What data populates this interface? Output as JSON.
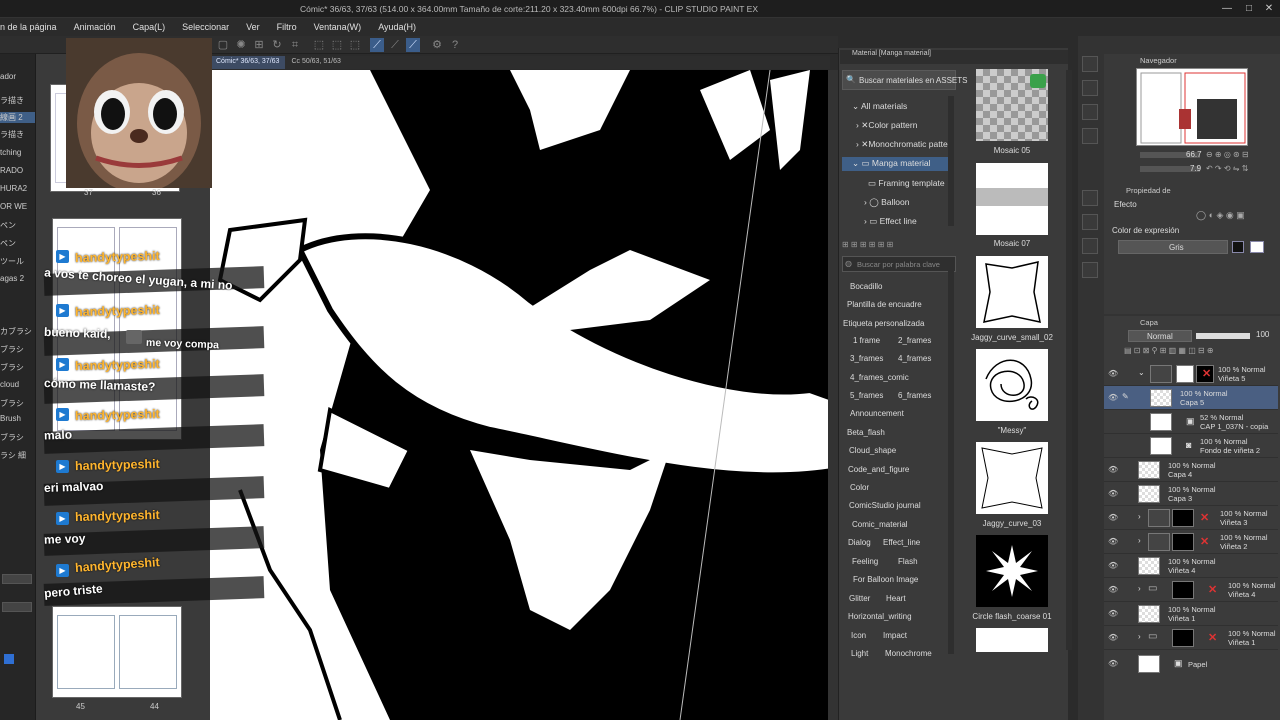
{
  "window": {
    "title": "Cómic* 36/63, 37/63 (514.00 x 364.00mm Tamaño de corte:211.20 x 323.40mm 600dpi 66.7%) - CLIP STUDIO PAINT EX"
  },
  "menu": [
    "n de la página",
    "Animación",
    "Capa(L)",
    "Seleccionar",
    "Ver",
    "Filtro",
    "Ventana(W)",
    "Ayuda(H)"
  ],
  "doc_tabs": [
    "Cómic* 36/63, 37/63",
    "Cc 50/63, 51/63"
  ],
  "left_tools": [
    "ador",
    "ラ描き",
    "線画 2",
    "ラ描き",
    "tching",
    "RADO",
    "HURA2",
    "OR WE",
    "ペン",
    "ペン",
    "ツール",
    "agas 2",
    "カブラシ",
    "ブラシ",
    "ブラシ",
    "cloud",
    "ブラシ",
    "Brush",
    "ブラシ",
    "ラシ 細"
  ],
  "page_numbers": {
    "top_left": "37",
    "top_right": "36",
    "bottom_left": "45",
    "bottom_right": "44"
  },
  "chat": [
    {
      "name": "handytypeshit",
      "message": "a vos te choreo el yugan, a mi no"
    },
    {
      "name": "handytypeshit",
      "message": "bueno kaid,",
      "message_tail": "me voy compa"
    },
    {
      "name": "handytypeshit",
      "message": "cómo me llamaste?"
    },
    {
      "name": "handytypeshit",
      "message": "malo"
    },
    {
      "name": "handytypeshit",
      "message": "eri malvao"
    },
    {
      "name": "handytypeshit",
      "message": "me voy"
    },
    {
      "name": "handytypeshit",
      "message": "pero triste"
    }
  ],
  "material_panel": {
    "header": "Material [Manga material]",
    "assets_button": "Buscar materiales en ASSETS",
    "tree": [
      {
        "label": "All materials",
        "level": 0
      },
      {
        "label": "Color pattern",
        "level": 1
      },
      {
        "label": "Monochromatic patte",
        "level": 1
      },
      {
        "label": "Manga material",
        "level": 1,
        "selected": true
      },
      {
        "label": "Framing template",
        "level": 2
      },
      {
        "label": "Balloon",
        "level": 2
      },
      {
        "label": "Effect line",
        "level": 2
      }
    ],
    "keyword_search_placeholder": "Buscar por palabra clave",
    "tags": [
      [
        "Bocadillo"
      ],
      [
        "Plantilla de encuadre"
      ],
      [
        "Etiqueta personalizada"
      ],
      [
        "1 frame",
        "2_frames"
      ],
      [
        "3_frames",
        "4_frames"
      ],
      [
        "4_frames_comic"
      ],
      [
        "5_frames",
        "6_frames"
      ],
      [
        "Announcement"
      ],
      [
        "Beta_flash"
      ],
      [
        "Cloud_shape"
      ],
      [
        "Code_and_figure"
      ],
      [
        "Color"
      ],
      [
        "ComicStudio journal"
      ],
      [
        "Comic_material"
      ],
      [
        "Dialog",
        "Effect_line"
      ],
      [
        "Feeling",
        "Flash"
      ],
      [
        "For Balloon Image"
      ],
      [
        "Glitter",
        "Heart"
      ],
      [
        "Horizontal_writing"
      ],
      [
        "Icon",
        "Impact"
      ],
      [
        "Light",
        "Monochrome"
      ]
    ],
    "tiles": [
      "Mosaic 05",
      "Mosaic 07",
      "Jaggy_curve_small_02",
      "\"Messy\"",
      "Jaggy_curve_03",
      "Circle flash_coarse 01"
    ]
  },
  "navigator": {
    "title": "Navegador",
    "zoom": "66.7",
    "angle": "7.9"
  },
  "properties": {
    "title": "Propiedad de",
    "effect_label": "Efecto",
    "expr_color_label": "Color de expresión",
    "expr_color_value": "Gris"
  },
  "layers": {
    "title": "Capa",
    "blend_mode": "Normal",
    "opacity": "100",
    "items": [
      {
        "opacity": "100 % Normal",
        "name": "Viñeta 5"
      },
      {
        "opacity": "100 % Normal",
        "name": "Capa 5",
        "selected": true
      },
      {
        "opacity": "52 % Normal",
        "name": "CAP 1_037N - copia"
      },
      {
        "opacity": "100 % Normal",
        "name": "Fondo de viñeta 2"
      },
      {
        "opacity": "100 % Normal",
        "name": "Capa 4"
      },
      {
        "opacity": "100 % Normal",
        "name": "Capa 3"
      },
      {
        "opacity": "100 % Normal",
        "name": "Viñeta 3"
      },
      {
        "opacity": "100 % Normal",
        "name": "Viñeta 2"
      },
      {
        "opacity": "100 % Normal",
        "name": "Viñeta 4"
      },
      {
        "opacity": "100 % Normal",
        "name": "Viñeta 4"
      },
      {
        "opacity": "100 % Normal",
        "name": "Viñeta 1"
      },
      {
        "opacity": "100 % Normal",
        "name": "Viñeta 1"
      },
      {
        "opacity": "",
        "name": "Papel"
      }
    ]
  },
  "colors": {
    "accent": "#3f5f87",
    "chat_name": "#ffb52e",
    "layer_mask_red": "#d33"
  }
}
